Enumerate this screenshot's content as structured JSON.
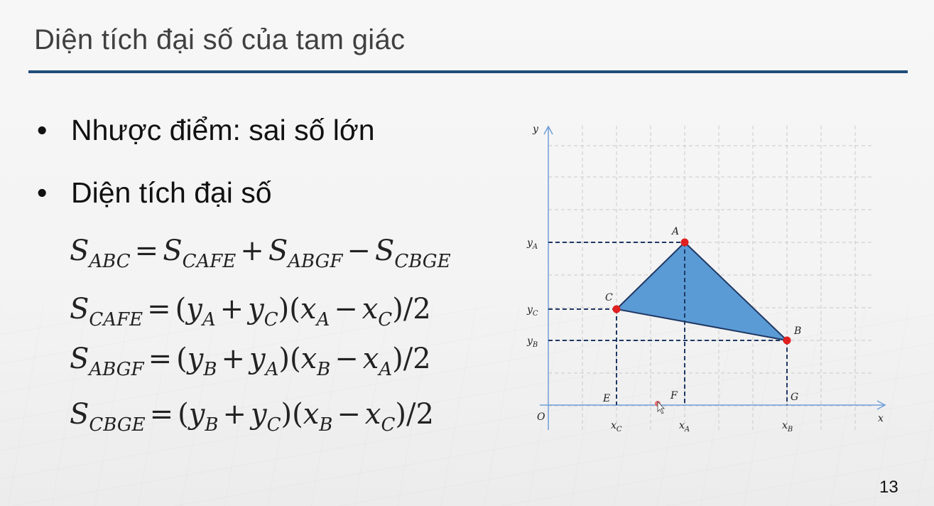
{
  "slide": {
    "title": "Diện tích đại số của tam giác",
    "page_number": "13"
  },
  "bullets": [
    {
      "marker": "•",
      "text": "Nhược điểm: sai số lớn"
    },
    {
      "marker": "•",
      "text": "Diện tích đại số"
    }
  ],
  "equations": {
    "eq1": {
      "lhs": "S",
      "lhs_sub": "ABC",
      "t1": "S",
      "t1_sub": "CAFE",
      "op1": "+",
      "t2": "S",
      "t2_sub": "ABGF",
      "op2": "−",
      "t3": "S",
      "t3_sub": "CBGE"
    },
    "eq2": {
      "lhs": "S",
      "lhs_sub": "CAFE",
      "a": "y",
      "a_sub": "A",
      "b": "y",
      "b_sub": "C",
      "c": "x",
      "c_sub": "A",
      "d": "x",
      "d_sub": "C"
    },
    "eq3": {
      "lhs": "S",
      "lhs_sub": "ABGF",
      "a": "y",
      "a_sub": "B",
      "b": "y",
      "b_sub": "A",
      "c": "x",
      "c_sub": "B",
      "d": "x",
      "d_sub": "A"
    },
    "eq4": {
      "lhs": "S",
      "lhs_sub": "CBGE",
      "a": "y",
      "a_sub": "B",
      "b": "y",
      "b_sub": "C",
      "c": "x",
      "c_sub": "B",
      "d": "x",
      "d_sub": "C"
    },
    "symbols": {
      "eq": "=",
      "plus": "+",
      "minus": "−",
      "open": "(",
      "close": ")",
      "div": "/2"
    }
  },
  "diagram": {
    "axis_y": "y",
    "axis_x": "x",
    "origin": "O",
    "points": {
      "A": "A",
      "B": "B",
      "C": "C",
      "E": "E",
      "F": "F",
      "G": "G"
    },
    "y_labels": [
      {
        "base": "y",
        "sub": "A"
      },
      {
        "base": "y",
        "sub": "C"
      },
      {
        "base": "y",
        "sub": "B"
      }
    ],
    "x_labels": [
      {
        "base": "x",
        "sub": "C"
      },
      {
        "base": "x",
        "sub": "A"
      },
      {
        "base": "x",
        "sub": "B"
      }
    ],
    "colors": {
      "triangle_fill": "#5b9bd5",
      "triangle_edge": "#1f3864",
      "axis": "#6f9fd8",
      "grid": "#c9c9c9",
      "dashed": "#1f3864",
      "vertex": "#e02020"
    }
  }
}
